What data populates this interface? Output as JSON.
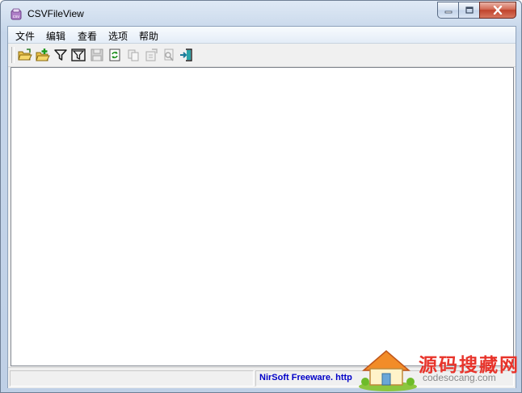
{
  "window": {
    "title": "CSVFileView",
    "icon": "csv-app-icon"
  },
  "caption_buttons": {
    "minimize_icon": "minimize-icon",
    "maximize_icon": "maximize-icon",
    "close_icon": "close-icon"
  },
  "menu": {
    "items": [
      {
        "label": "文件"
      },
      {
        "label": "编辑"
      },
      {
        "label": "查看"
      },
      {
        "label": "选项"
      },
      {
        "label": "帮助"
      }
    ]
  },
  "toolbar": {
    "buttons": [
      {
        "icon": "open-folder-icon",
        "enabled": true
      },
      {
        "icon": "open-add-folder-icon",
        "enabled": true
      },
      {
        "icon": "filter-icon",
        "enabled": true
      },
      {
        "icon": "filter-box-icon",
        "enabled": true
      },
      {
        "icon": "save-icon",
        "enabled": false
      },
      {
        "icon": "refresh-icon",
        "enabled": true
      },
      {
        "icon": "copy-icon",
        "enabled": false
      },
      {
        "icon": "properties-icon",
        "enabled": false
      },
      {
        "icon": "find-icon",
        "enabled": false
      },
      {
        "icon": "exit-icon",
        "enabled": true
      }
    ]
  },
  "statusbar": {
    "link_text": "NirSoft Freeware.  http"
  },
  "watermark": {
    "site_name": "源码搜藏网",
    "site_url": "codesocang.com"
  },
  "colors": {
    "link": "#0000c8",
    "watermark_red": "#e8342b",
    "close_button": "#c0432c"
  }
}
